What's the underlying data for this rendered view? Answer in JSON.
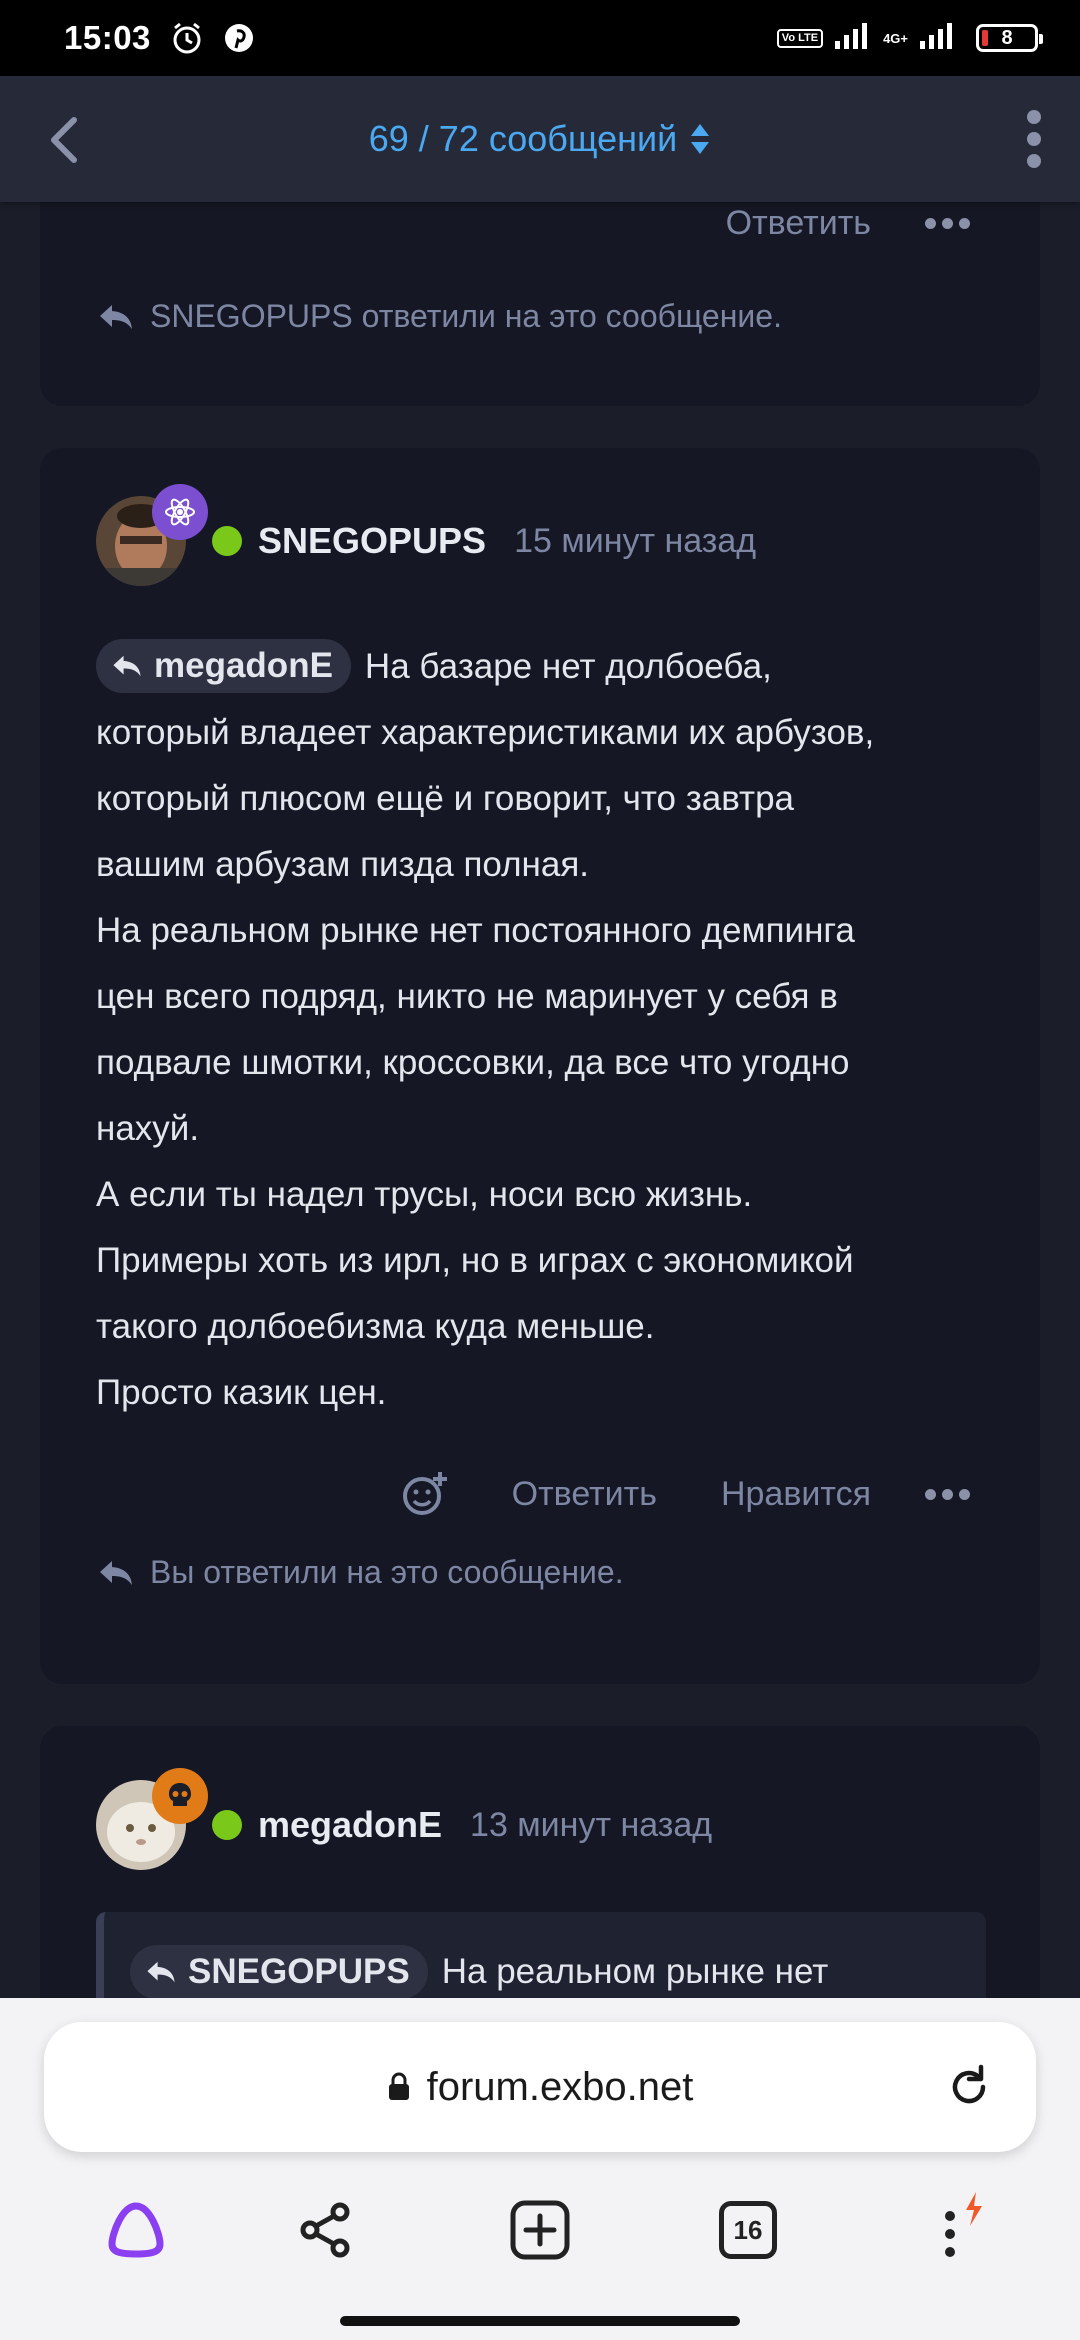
{
  "status_bar": {
    "time": "15:03",
    "network_label": "4G+",
    "lte_label": "Vo LTE",
    "battery": "8"
  },
  "app_bar": {
    "counter": "69 / 72 сообщений"
  },
  "prev_post": {
    "reply_label": "Ответить",
    "reply_note": "SNEGOPUPS ответили на это сообщение."
  },
  "post": {
    "username": "SNEGOPUPS",
    "time": "15 минут назад",
    "mention": "megadonE",
    "lines": [
      "На базаре нет долбоеба,",
      "который владеет характеристиками их арбузов,",
      "который плюсом ещё и говорит, что завтра",
      "вашим арбузам пизда полная.",
      "На реальном рынке нет постоянного демпинга",
      "цен всего подряд, никто не маринует у себя в",
      "подвале шмотки, кроссовки, да все что угодно",
      "нахуй.",
      "А если ты надел трусы, носи всю жизнь.",
      "Примеры хоть из ирл, но в играх с экономикой",
      "такого долбоебизма куда меньше.",
      "Просто казик цен."
    ],
    "reply_label": "Ответить",
    "like_label": "Нравится",
    "reply_note": "Вы ответили на это сообщение."
  },
  "next_post": {
    "username": "megadonE",
    "time": "13 минут назад",
    "quote_mention": "SNEGOPUPS",
    "quote_text": "На реальном рынке нет"
  },
  "browser": {
    "url": "forum.exbo.net",
    "tabs_count": "16"
  },
  "colors": {
    "accent": "#4aa9f0",
    "online": "#7ac81a",
    "badge_purple": "#7b4fd0",
    "badge_orange": "#e07b18"
  }
}
